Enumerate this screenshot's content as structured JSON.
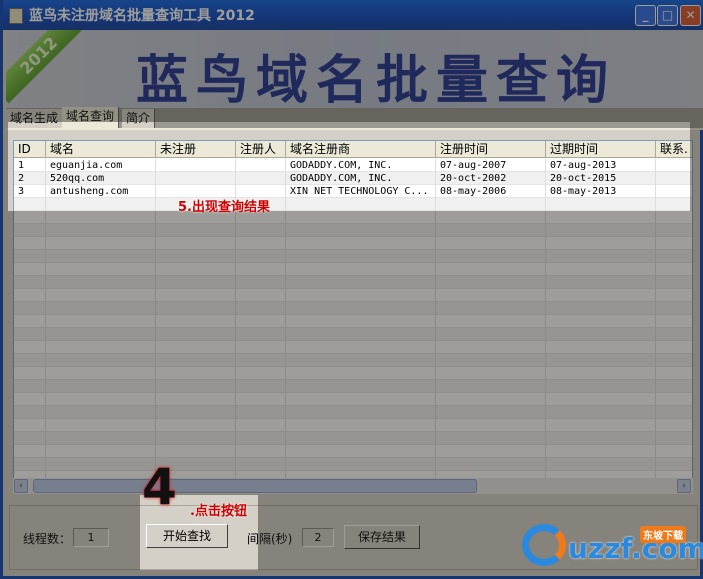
{
  "window": {
    "title": "蓝鸟未注册域名批量查询工具 2012",
    "banner_title": "蓝鸟域名批量查询",
    "banner_year": "2012",
    "controls": {
      "minimize": "_",
      "maximize": "□",
      "close": "✕"
    }
  },
  "tabs": [
    {
      "label": "域名生成"
    },
    {
      "label": "域名查询",
      "active": true
    },
    {
      "label": "简介"
    }
  ],
  "grid": {
    "columns": [
      "ID",
      "域名",
      "未注册",
      "注册人",
      "域名注册商",
      "注册时间",
      "过期时间",
      "联系."
    ],
    "rows": [
      [
        "1",
        "eguanjia.com",
        "",
        "",
        "GODADDY.COM, INC.",
        "07-aug-2007",
        "07-aug-2013",
        ""
      ],
      [
        "2",
        "520qq.com",
        "",
        "",
        "GODADDY.COM, INC.",
        "20-oct-2002",
        "20-oct-2015",
        ""
      ],
      [
        "3",
        "antusheng.com",
        "",
        "",
        "XIN NET TECHNOLOGY C...",
        "08-may-2006",
        "08-may-2013",
        ""
      ]
    ]
  },
  "controls": {
    "threads_label": "线程数：",
    "threads_value": "1",
    "start_button": "开始查找",
    "interval_label": "间隔(秒)",
    "interval_value": "2",
    "save_button": "保存结果"
  },
  "annotations": {
    "step4_number": "4",
    "step4_text": ".点击按钮",
    "step5_text": "5.出现查询结果"
  },
  "watermark": {
    "text": "uzzf.com",
    "badge": "东坡下载"
  },
  "colors": {
    "titlebar": "#0a5fe0",
    "banner_text": "#1a2c8c",
    "annotation": "#cc0000"
  }
}
